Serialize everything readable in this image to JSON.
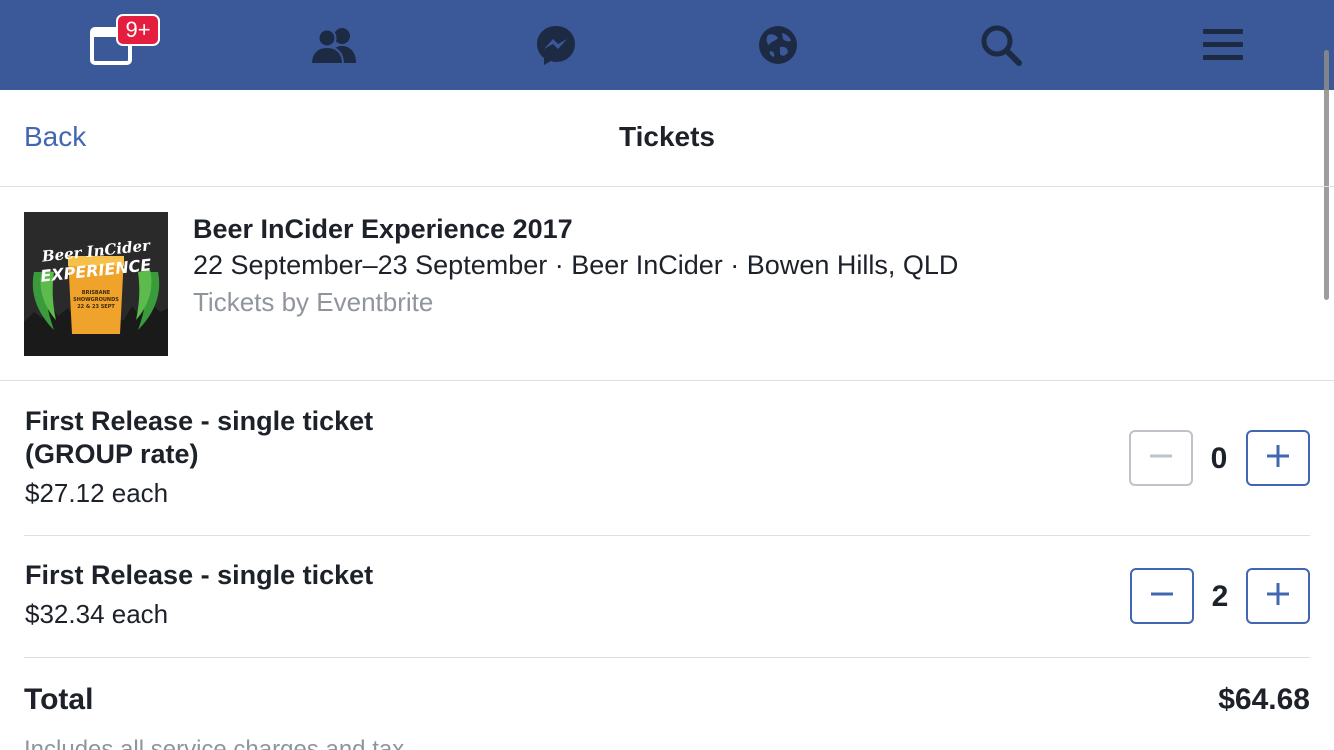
{
  "nav": {
    "tabs": [
      {
        "icon": "news-feed-icon"
      },
      {
        "icon": "friends-icon"
      },
      {
        "icon": "messenger-icon"
      },
      {
        "icon": "globe-icon"
      },
      {
        "icon": "search-icon"
      },
      {
        "icon": "menu-icon"
      }
    ],
    "badge": "9+",
    "color": "#3b5998",
    "badge_color": "#e41e3f"
  },
  "header": {
    "back_label": "Back",
    "title": "Tickets"
  },
  "event": {
    "name": "Beer InCider Experience 2017",
    "details": "22 September–23 September · Beer InCider · Bowen Hills, QLD",
    "provider": "Tickets by Eventbrite",
    "thumb_text": {
      "line1": "Beer InCider",
      "line2": "EXPERIENCE",
      "line3": "BRISBANE",
      "line4": "SHOWGROUNDS",
      "line5": "22 & 23 SEPT"
    }
  },
  "tickets": [
    {
      "name": "First Release - single ticket (GROUP rate)",
      "price": "$27.12 each",
      "quantity": "0",
      "decrement_enabled": false
    },
    {
      "name": "First Release - single ticket",
      "price": "$32.34 each",
      "quantity": "2",
      "decrement_enabled": true
    }
  ],
  "total": {
    "label": "Total",
    "value": "$64.68",
    "note": "Includes all service charges and tax"
  },
  "colors": {
    "accent": "#4267b2",
    "text": "#1d2129",
    "muted": "#90949c",
    "divider": "#dddfe2"
  }
}
